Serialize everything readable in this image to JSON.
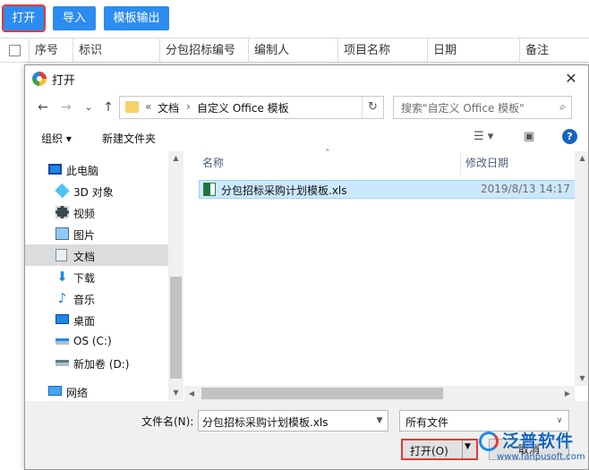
{
  "toolbar": {
    "open_label": "打开",
    "import_label": "导入",
    "template_export_label": "模板输出"
  },
  "table": {
    "headers": [
      "序号",
      "标识",
      "分包招标编号",
      "编制人",
      "项目名称",
      "日期",
      "备注"
    ]
  },
  "dialog": {
    "title": "打开",
    "close_glyph": "✕",
    "nav": {
      "back": "←",
      "forward": "→",
      "recent": "⌄",
      "up": "↑"
    },
    "address": {
      "overflow": "«",
      "segments": [
        "文档",
        "自定义 Office 模板"
      ],
      "separator": "›"
    },
    "search_placeholder": "搜索\"自定义 Office 模板\"",
    "commands": {
      "organize": "组织 ▾",
      "new_folder": "新建文件夹"
    },
    "nav_pane": [
      {
        "label": "此电脑",
        "icon": "computer-icon"
      },
      {
        "label": "3D 对象",
        "icon": "cube-icon"
      },
      {
        "label": "视频",
        "icon": "video-icon"
      },
      {
        "label": "图片",
        "icon": "picture-icon"
      },
      {
        "label": "文档",
        "icon": "document-icon",
        "selected": true
      },
      {
        "label": "下载",
        "icon": "download-icon"
      },
      {
        "label": "音乐",
        "icon": "music-icon"
      },
      {
        "label": "桌面",
        "icon": "desktop-icon"
      },
      {
        "label": "OS (C:)",
        "icon": "drive-icon"
      },
      {
        "label": "新加卷 (D:)",
        "icon": "drive-icon"
      },
      {
        "label": "网络",
        "icon": "network-icon"
      }
    ],
    "columns": {
      "name": "名称",
      "modified": "修改日期"
    },
    "files": [
      {
        "name": "分包招标采购计划模板.xls",
        "modified": "2019/8/13 14:17",
        "icon": "excel-file-icon"
      }
    ],
    "filename_label": "文件名(N):",
    "filename_value": "分包招标采购计划模板.xls",
    "filetype_value": "所有文件",
    "open_button": "打开(O)",
    "cancel_button": "取消"
  },
  "watermark": {
    "brand": "泛普软件",
    "url": "www.fanpusoft.com"
  },
  "colors": {
    "accent_blue": "#2d8cf0",
    "highlight_red": "#e53935",
    "selection": "#cce8ff"
  }
}
